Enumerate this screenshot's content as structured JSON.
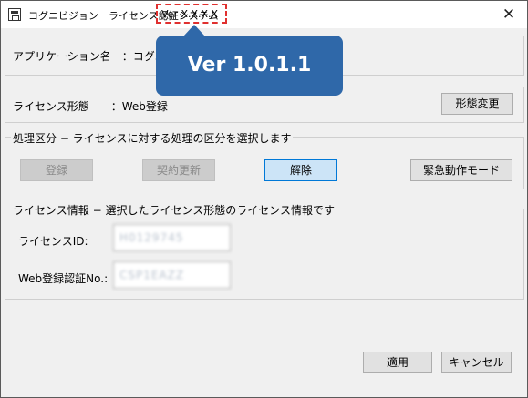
{
  "titlebar": {
    "title": "コグニビジョン　ライセンス認証システム",
    "version": "Ver X.X.X.X",
    "close_glyph": "✕"
  },
  "app_section": {
    "label": "アプリケーション名　：コグニ"
  },
  "license_type_section": {
    "label": "ライセンス形態　　：Web登録",
    "change_button": "形態変更"
  },
  "process_section": {
    "title": "処理区分 − ライセンスに対する処理の区分を選択します",
    "buttons": {
      "register": "登録",
      "renew": "契約更新",
      "release": "解除",
      "emergency": "緊急動作モード"
    }
  },
  "info_section": {
    "title": "ライセンス情報 − 選択したライセンス形態のライセンス情報です",
    "license_id_label": "ライセンスID:",
    "license_id_value": "H0129745",
    "web_auth_label": "Web登録認証No.:",
    "web_auth_value": "CSP1EAZZ"
  },
  "footer": {
    "apply_button": "適用",
    "cancel_button": "キャンセル"
  },
  "callout": {
    "text": "Ver 1.0.1.1",
    "color": "#2f68a9"
  },
  "colors": {
    "highlight_border": "#e0302f",
    "focus_accent": "#0078d7"
  }
}
